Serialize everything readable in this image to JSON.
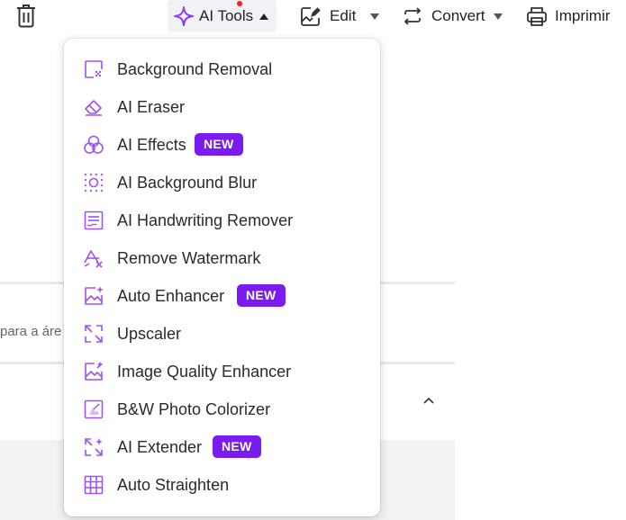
{
  "toolbar": {
    "ai_tools_label": "AI Tools",
    "edit_label": "Edit",
    "convert_label": "Convert",
    "print_label": "Imprimir"
  },
  "background": {
    "partial_text": "para a áre"
  },
  "menu": {
    "badge_new": "NEW",
    "items": [
      {
        "label": "Background Removal",
        "icon": "background-removal-icon"
      },
      {
        "label": "AI Eraser",
        "icon": "eraser-icon"
      },
      {
        "label": "AI Effects",
        "icon": "effects-icon",
        "badge": "NEW"
      },
      {
        "label": "AI Background Blur",
        "icon": "background-blur-icon"
      },
      {
        "label": "AI Handwriting Remover",
        "icon": "handwriting-remover-icon"
      },
      {
        "label": "Remove Watermark",
        "icon": "watermark-icon"
      },
      {
        "label": "Auto Enhancer",
        "icon": "auto-enhancer-icon",
        "badge": "NEW"
      },
      {
        "label": "Upscaler",
        "icon": "upscaler-icon"
      },
      {
        "label": "Image Quality Enhancer",
        "icon": "quality-enhancer-icon"
      },
      {
        "label": "B&W Photo Colorizer",
        "icon": "colorizer-icon"
      },
      {
        "label": "AI Extender",
        "icon": "extender-icon",
        "badge": "NEW"
      },
      {
        "label": "Auto Straighten",
        "icon": "straighten-icon"
      }
    ]
  },
  "colors": {
    "accent": "#7a1cf0",
    "icon": "#a052f0",
    "notification_dot": "#ff1a1a"
  }
}
